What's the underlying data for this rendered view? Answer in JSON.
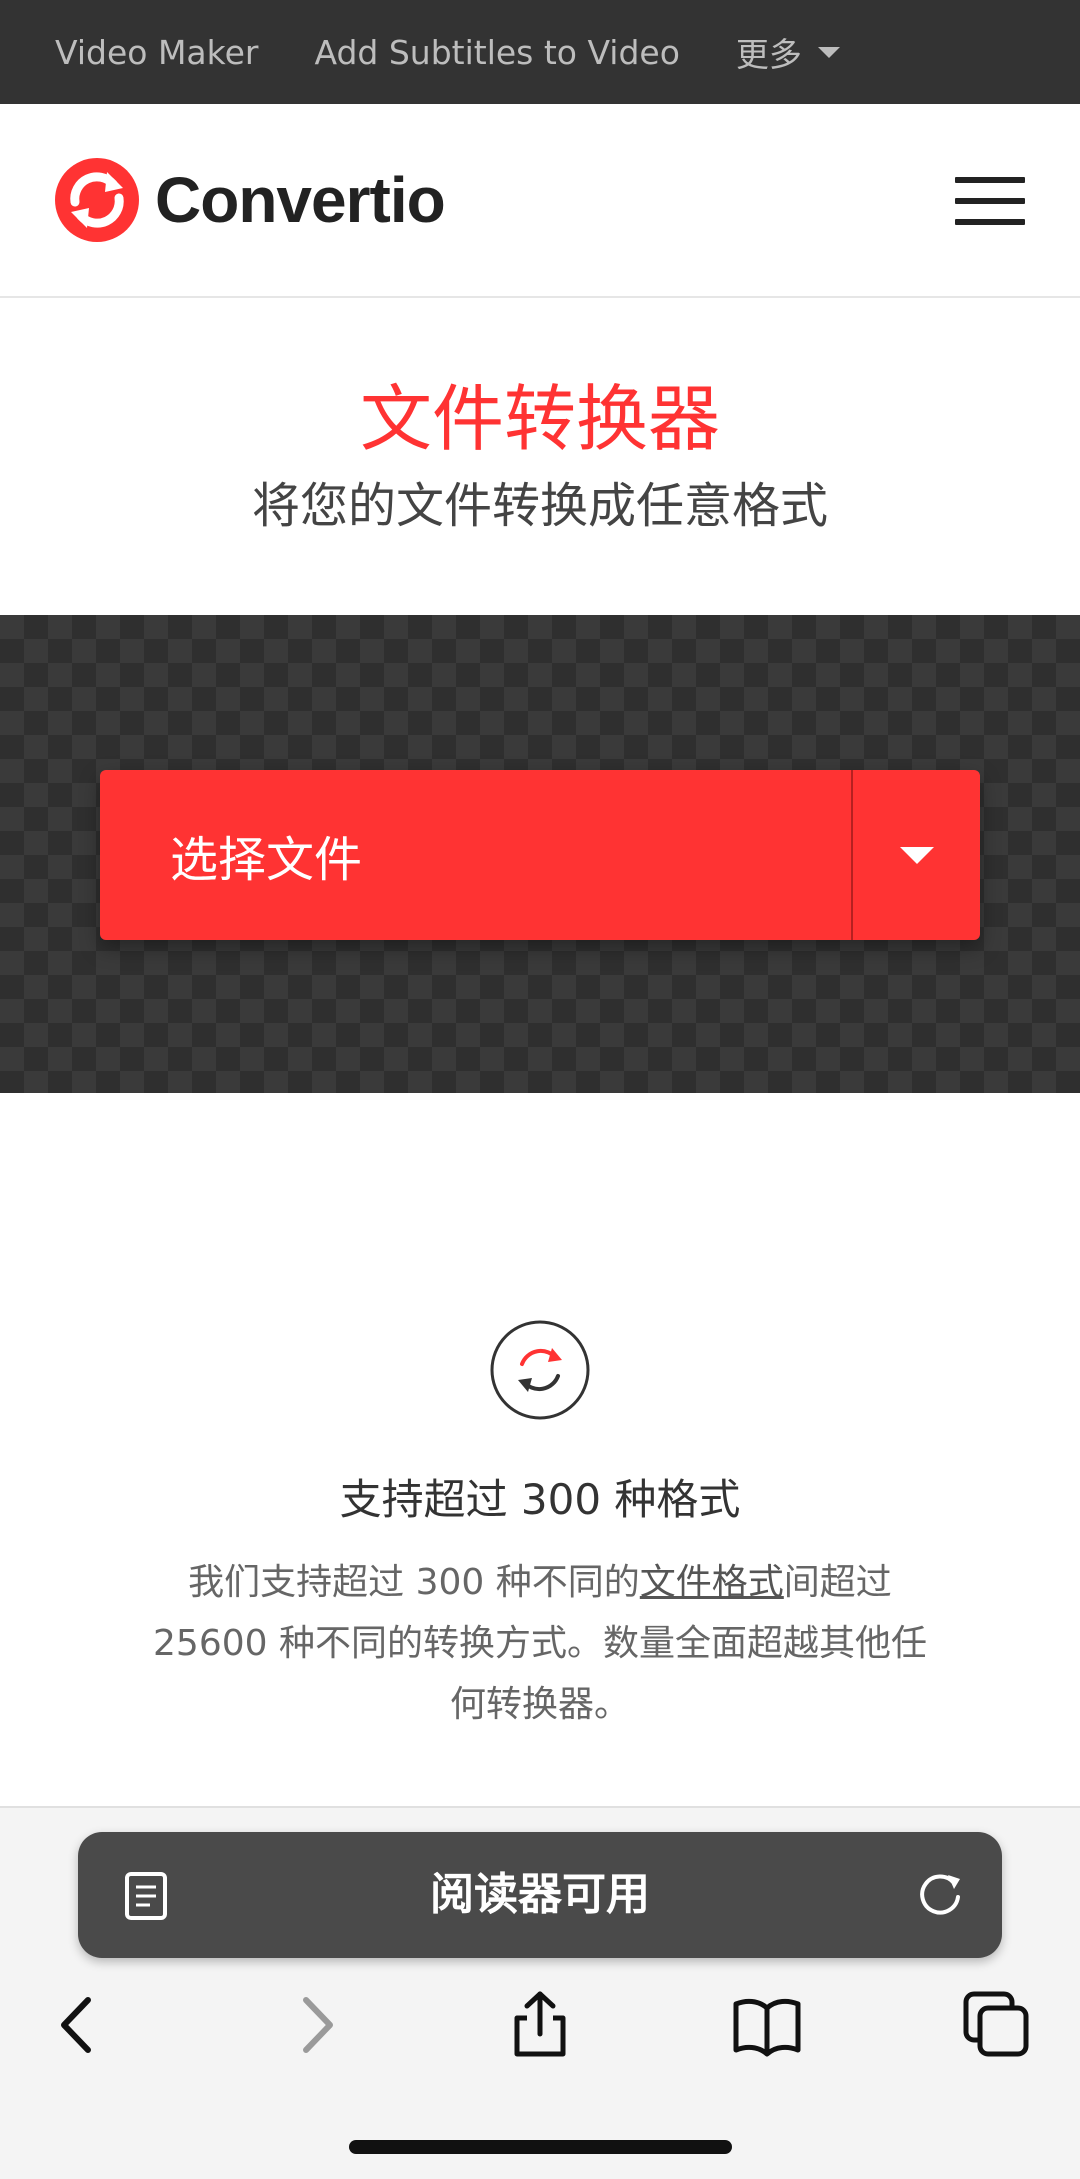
{
  "topnav": {
    "links": [
      "Video Maker",
      "Add Subtitles to Video"
    ],
    "more_label": "更多"
  },
  "header": {
    "brand": "Convertio",
    "logo_color": "#ff3333"
  },
  "hero": {
    "title": "文件转换器",
    "subtitle": "将您的文件转换成任意格式",
    "title_color": "#ff3333"
  },
  "upload": {
    "choose_label": "选择文件",
    "button_color": "#ff3333"
  },
  "features": {
    "icon": "convert-refresh-icon",
    "title": "支持超过 300 种格式",
    "desc_part1": "我们支持超过 300 种不同的",
    "desc_link": "文件格式",
    "desc_part2": "间超过 25600 种不同的转换方式。数量全面超越其他任何转换器。"
  },
  "safari": {
    "reader_label": "阅读器可用",
    "icons": [
      "back-icon",
      "forward-icon",
      "share-icon",
      "bookmarks-icon",
      "tabs-icon"
    ]
  }
}
